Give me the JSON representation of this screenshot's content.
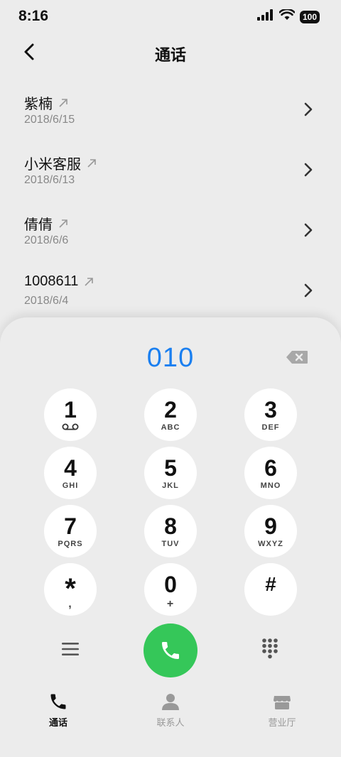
{
  "status": {
    "time": "8:16",
    "battery": "100"
  },
  "header": {
    "title": "通话"
  },
  "calls": [
    {
      "name": "紫楠",
      "date": "2018/6/15"
    },
    {
      "name": "小米客服",
      "date": "2018/6/13"
    },
    {
      "name": "倩倩",
      "date": "2018/6/6"
    },
    {
      "name": "1008611",
      "date": "2018/6/4"
    }
  ],
  "dialer": {
    "number": "010",
    "keys": [
      {
        "digit": "1",
        "letters": ""
      },
      {
        "digit": "2",
        "letters": "ABC"
      },
      {
        "digit": "3",
        "letters": "DEF"
      },
      {
        "digit": "4",
        "letters": "GHI"
      },
      {
        "digit": "5",
        "letters": "JKL"
      },
      {
        "digit": "6",
        "letters": "MNO"
      },
      {
        "digit": "7",
        "letters": "PQRS"
      },
      {
        "digit": "8",
        "letters": "TUV"
      },
      {
        "digit": "9",
        "letters": "WXYZ"
      },
      {
        "digit": "*",
        "letters": ","
      },
      {
        "digit": "0",
        "letters": "+"
      },
      {
        "digit": "#",
        "letters": ""
      }
    ]
  },
  "tabs": [
    {
      "label": "通话",
      "active": true
    },
    {
      "label": "联系人",
      "active": false
    },
    {
      "label": "营业厅",
      "active": false
    }
  ],
  "colors": {
    "accent": "#1a7ff0",
    "call_green": "#35c759",
    "background": "#ececec"
  }
}
